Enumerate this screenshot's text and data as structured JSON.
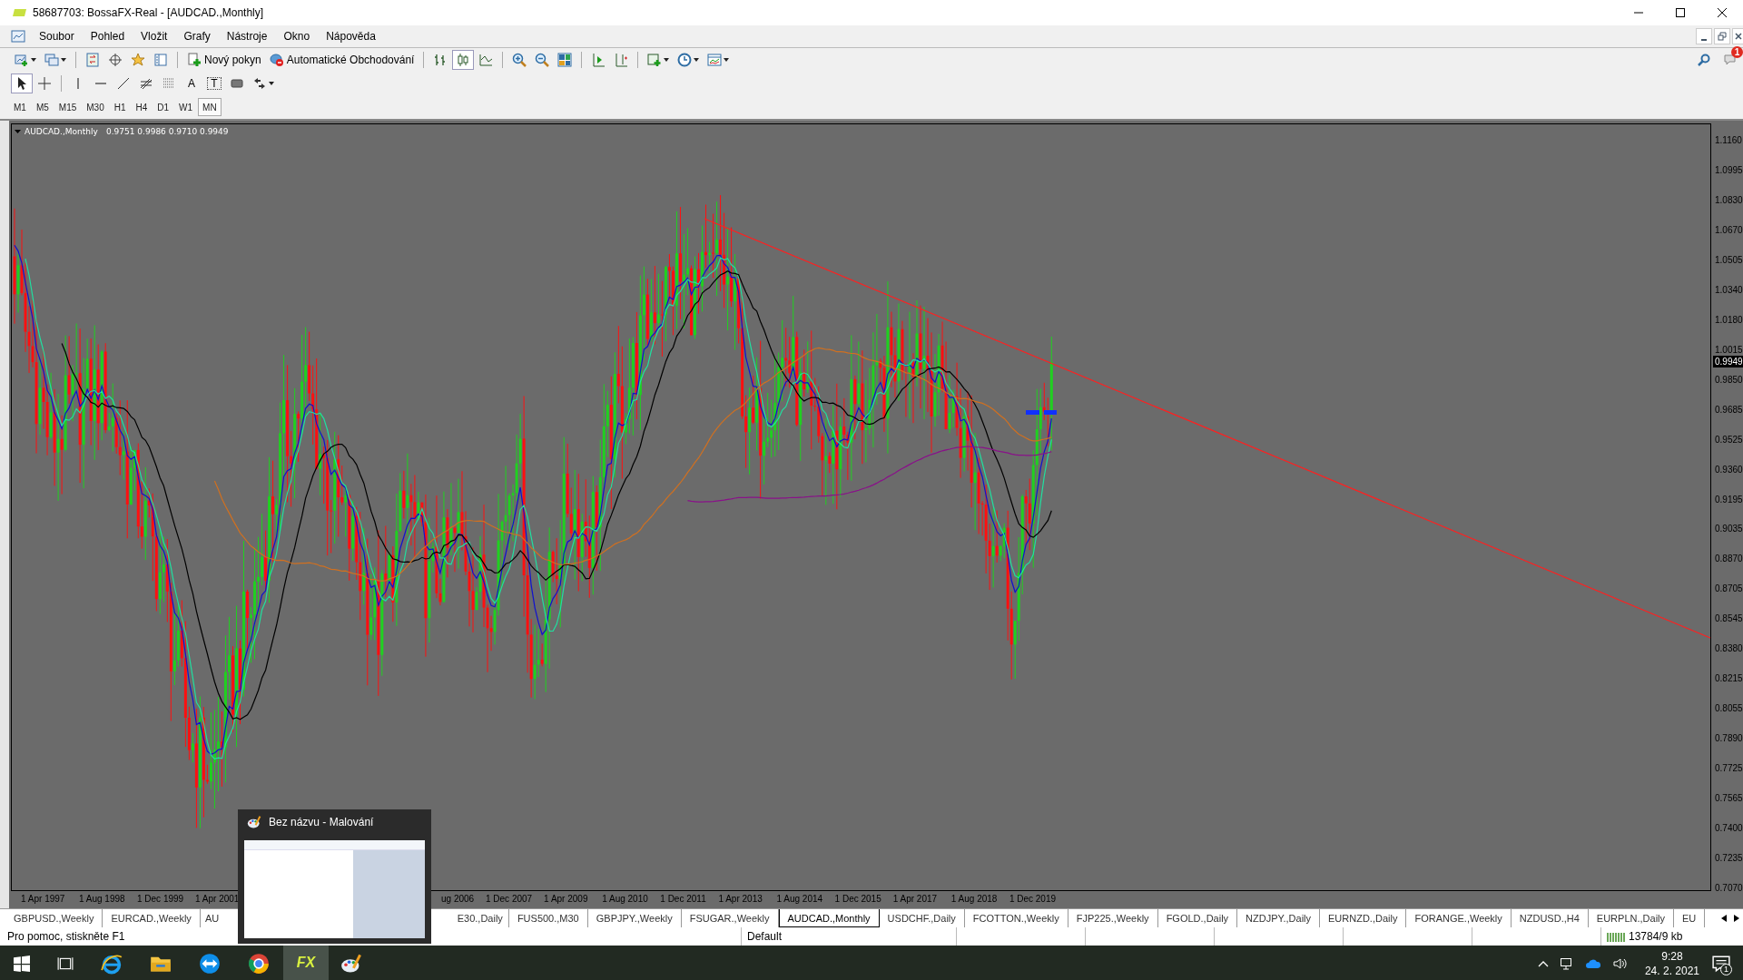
{
  "window": {
    "title": "58687703: BossaFX-Real - [AUDCAD.,Monthly]"
  },
  "menu": [
    "Soubor",
    "Pohled",
    "Vložit",
    "Grafy",
    "Nástroje",
    "Okno",
    "Nápověda"
  ],
  "toolbar": {
    "buttons": [
      {
        "label": "Nový pokyn"
      },
      {
        "label": "Automatické Obchodování"
      }
    ],
    "chart_types": [
      {
        "selected": false
      },
      {
        "selected": true
      },
      {
        "selected": false
      }
    ],
    "notification_badge": "1"
  },
  "drawing_toolbar": {
    "cursor": {
      "selected": true
    },
    "text_tool": "A",
    "text_label_tool": "T"
  },
  "timeframes": [
    {
      "label": "M1",
      "selected": false
    },
    {
      "label": "M5",
      "selected": false
    },
    {
      "label": "M15",
      "selected": false
    },
    {
      "label": "M30",
      "selected": false
    },
    {
      "label": "H1",
      "selected": false
    },
    {
      "label": "H4",
      "selected": false
    },
    {
      "label": "D1",
      "selected": false
    },
    {
      "label": "W1",
      "selected": false
    },
    {
      "label": "MN",
      "selected": true
    }
  ],
  "chart": {
    "symbol": "AUDCAD.,Monthly",
    "ohlc": "0.9751 0.9986 0.9710 0.9949",
    "price_labels": [
      "1.1160",
      "1.0995",
      "1.0830",
      "1.0670",
      "1.0505",
      "1.0340",
      "1.0180",
      "1.0015",
      "0.9850",
      "0.9685",
      "0.9525",
      "0.9360",
      "0.9195",
      "0.9035",
      "0.8870",
      "0.8705",
      "0.8545",
      "0.8380",
      "0.8215",
      "0.8055",
      "0.7890",
      "0.7725",
      "0.7565",
      "0.7400",
      "0.7235",
      "0.7070"
    ],
    "current_price": "0.9949",
    "date_labels_left": [
      "1 Apr 1997",
      "1 Aug 1998",
      "1 Dec 1999",
      "1 Apr 2001"
    ],
    "date_labels_right": [
      "ug 2006",
      "1 Dec 2007",
      "1 Apr 2009",
      "1 Aug 2010",
      "1 Dec 2011",
      "1 Apr 2013",
      "1 Aug 2014",
      "1 Dec 2015",
      "1 Apr 2017",
      "1 Aug 2018",
      "1 Dec 2019"
    ]
  },
  "tabs": [
    {
      "label": "GBPUSD.,Weekly",
      "selected": false,
      "kind": "full"
    },
    {
      "label": "EURCAD.,Weekly",
      "selected": false,
      "kind": "full"
    },
    {
      "label": "AU",
      "selected": false,
      "kind": "cut_right"
    },
    {
      "label": "E30.,Daily",
      "selected": false,
      "kind": "cut_left"
    },
    {
      "label": "FUS500.,M30",
      "selected": false,
      "kind": "full"
    },
    {
      "label": "GBPJPY.,Weekly",
      "selected": false,
      "kind": "full"
    },
    {
      "label": "FSUGAR.,Weekly",
      "selected": false,
      "kind": "full"
    },
    {
      "label": "AUDCAD.,Monthly",
      "selected": true,
      "kind": "full"
    },
    {
      "label": "USDCHF.,Daily",
      "selected": false,
      "kind": "full"
    },
    {
      "label": "FCOTTON.,Weekly",
      "selected": false,
      "kind": "full"
    },
    {
      "label": "FJP225.,Weekly",
      "selected": false,
      "kind": "full"
    },
    {
      "label": "FGOLD.,Daily",
      "selected": false,
      "kind": "full"
    },
    {
      "label": "NZDJPY.,Daily",
      "selected": false,
      "kind": "full"
    },
    {
      "label": "EURNZD.,Daily",
      "selected": false,
      "kind": "full"
    },
    {
      "label": "FORANGE.,Weekly",
      "selected": false,
      "kind": "full"
    },
    {
      "label": "NZDUSD.,H4",
      "selected": false,
      "kind": "full"
    },
    {
      "label": "EURPLN.,Daily",
      "selected": false,
      "kind": "full"
    },
    {
      "label": "EU",
      "selected": false,
      "kind": "full"
    }
  ],
  "status_bar": {
    "help": "Pro pomoc, stiskněte F1",
    "profile": "Default",
    "traffic": "13784/9 kb"
  },
  "taskbar_popup": {
    "title": "Bez názvu - Malování"
  },
  "taskbar": {
    "fx_label": "FX",
    "time": "9:28",
    "date": "24. 2. 2021",
    "notification_count": "1"
  }
}
